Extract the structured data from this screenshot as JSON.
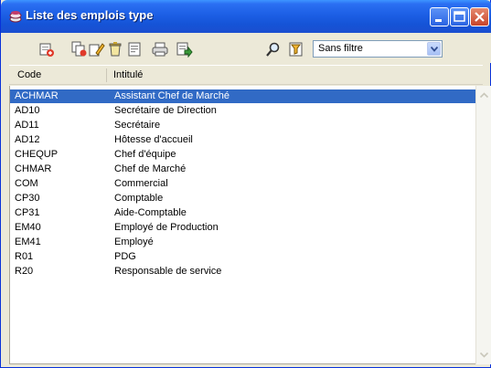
{
  "window": {
    "title": "Liste des emplois type",
    "title_icon": "app-icon",
    "buttons": [
      "minimize",
      "maximize",
      "close"
    ]
  },
  "toolbar": {
    "tools": [
      "new-record-icon",
      "copy-record-icon",
      "edit-record-icon",
      "delete-record-icon",
      "view-record-icon",
      "print-icon",
      "export-icon",
      "search-icon",
      "filter-icon"
    ],
    "filter": {
      "selected": "Sans filtre"
    }
  },
  "columns": {
    "code": "Code",
    "label": "Intitulé"
  },
  "rows": [
    {
      "code": "ACHMAR",
      "label": "Assistant Chef de Marché",
      "selected": true
    },
    {
      "code": "AD10",
      "label": "Secrétaire de Direction"
    },
    {
      "code": "AD11",
      "label": "Secrétaire"
    },
    {
      "code": "AD12",
      "label": "Hôtesse d'accueil"
    },
    {
      "code": "CHEQUP",
      "label": "Chef d'équipe"
    },
    {
      "code": "CHMAR",
      "label": "Chef de Marché"
    },
    {
      "code": "COM",
      "label": "Commercial"
    },
    {
      "code": "CP30",
      "label": "Comptable"
    },
    {
      "code": "CP31",
      "label": "Aide-Comptable"
    },
    {
      "code": "EM40",
      "label": "Employé de Production"
    },
    {
      "code": "EM41",
      "label": "Employé"
    },
    {
      "code": "R01",
      "label": "PDG"
    },
    {
      "code": "R20",
      "label": "Responsable de service"
    }
  ],
  "colors": {
    "titlebar": "#1c5fe5",
    "selection": "#316ac5",
    "window_bg": "#ece9d8"
  }
}
